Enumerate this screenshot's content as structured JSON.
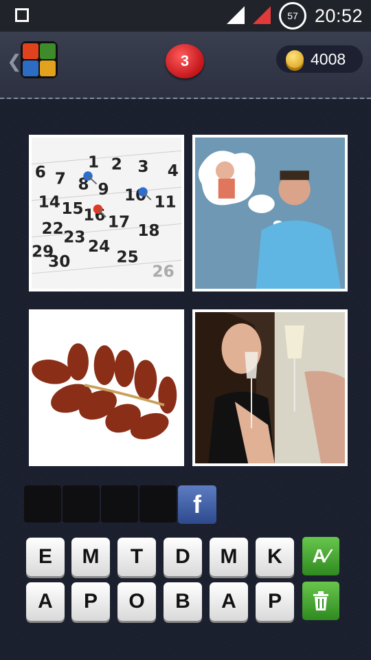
{
  "status_bar": {
    "battery_level": "57",
    "time": "20:52"
  },
  "header": {
    "level": "3",
    "coins": "4008"
  },
  "answer": {
    "slots": 4,
    "facebook_label": "f"
  },
  "letters": {
    "row1": [
      "E",
      "M",
      "T",
      "D",
      "M",
      "K"
    ],
    "row2": [
      "A",
      "P",
      "O",
      "B",
      "A",
      "P"
    ]
  },
  "colors": {
    "accent_red": "#d11f24",
    "accent_green": "#4caf35",
    "coin_gold": "#e8b32a"
  },
  "icons": {
    "hint": "letter-a-hint-icon",
    "delete": "trash-icon",
    "back": "chevron-left-icon",
    "coins": "coin-stack-icon"
  }
}
